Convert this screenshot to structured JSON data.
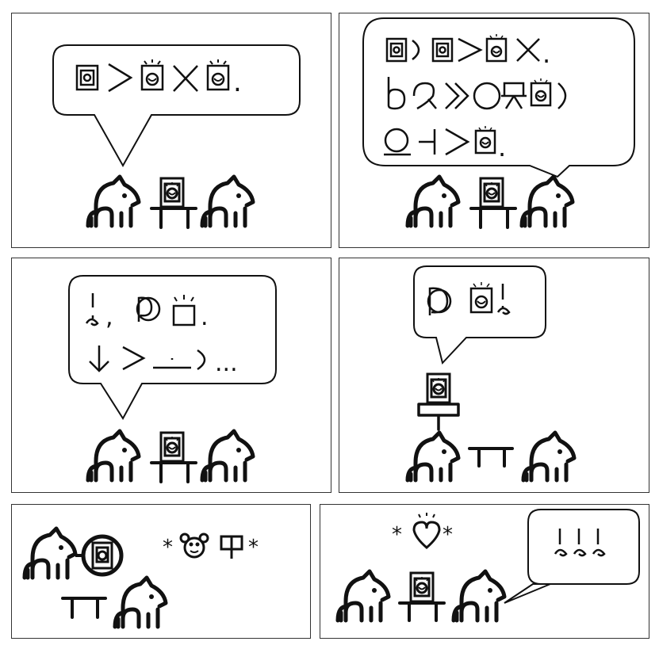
{
  "panels": [
    {
      "id": "panel-1",
      "speaker": "left-cat"
    },
    {
      "id": "panel-2",
      "speaker": "right-cat"
    },
    {
      "id": "panel-3",
      "speaker": "left-cat"
    },
    {
      "id": "panel-4",
      "speaker": "tv-on-table"
    },
    {
      "id": "panel-5",
      "speaker": "none"
    },
    {
      "id": "panel-6",
      "speaker": "right-cat"
    }
  ],
  "text": {
    "p3_comma": ",",
    "p3_period": ".",
    "p3_ellipsis": "...",
    "p1_period": ".",
    "p2_period_1": ".",
    "p2_period_2": ".",
    "p5_star_left": "*",
    "p5_star_right": "*",
    "p6_star_left": "*",
    "p6_star_right": "*"
  },
  "colors": {
    "ink": "#111111",
    "border": "#333333",
    "background": "#ffffff"
  },
  "icons": [
    "cat-icon",
    "tv-icon",
    "table-icon",
    "heart-icon",
    "bear-face-icon",
    "glyph-symbols"
  ]
}
